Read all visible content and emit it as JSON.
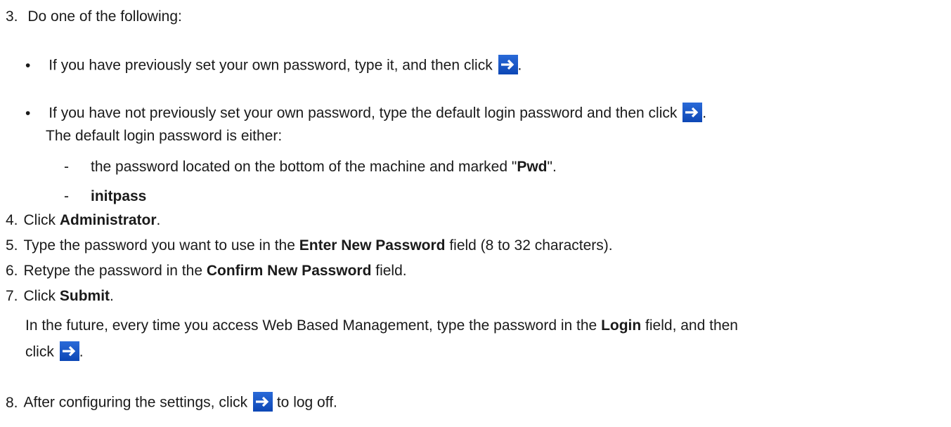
{
  "steps": {
    "s3": {
      "num": "3.",
      "text": "Do one of the following:"
    },
    "s3_b1": {
      "bullet": "•",
      "pre": "If you have previously set your own password, type it, and then click",
      "post": "."
    },
    "s3_b2": {
      "bullet": "•",
      "pre": "If you have not previously set your own password, type the default login password and then click",
      "post": "."
    },
    "s3_b2_note": "The default login password is either:",
    "s3_d1": {
      "dash": "-",
      "pre": "the password located on the bottom of the machine and marked \"",
      "bold": "Pwd",
      "post": "\"."
    },
    "s3_d2": {
      "dash": "-",
      "bold": "initpass"
    },
    "s4": {
      "num": "4.",
      "pre": "Click ",
      "bold": "Administrator",
      "post": "."
    },
    "s5": {
      "num": "5.",
      "pre": "Type the password you want to use in the ",
      "bold": "Enter New Password",
      "post": " field (8 to 32 characters)."
    },
    "s6": {
      "num": "6.",
      "pre": "Retype the password in the ",
      "bold": "Confirm New Password",
      "post": " field."
    },
    "s7": {
      "num": "7.",
      "pre": "Click ",
      "bold": "Submit",
      "post": "."
    },
    "s7_note1": {
      "pre": "In the future, every time you access Web Based Management, type the password in the ",
      "bold": "Login",
      "post": " field, and then"
    },
    "s7_note2": {
      "pre": "click",
      "post": "."
    },
    "s8": {
      "num": "8.",
      "pre": "After configuring the settings, click",
      "post": " to log off."
    }
  },
  "icons": {
    "login_arrow": "arrow-right-icon",
    "color": "#1f5fcf"
  }
}
